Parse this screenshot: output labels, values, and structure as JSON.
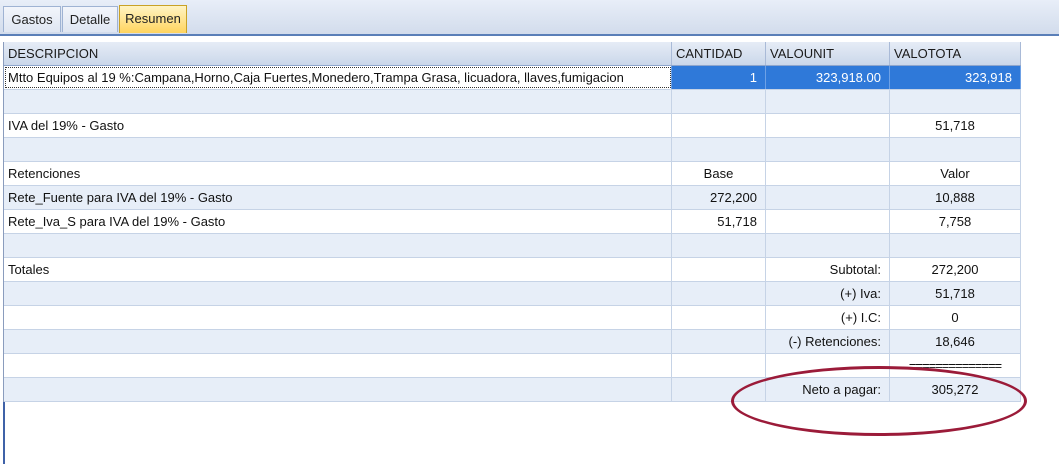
{
  "tabs": [
    {
      "label": "Gastos"
    },
    {
      "label": "Detalle"
    },
    {
      "label": "Resumen"
    }
  ],
  "grid": {
    "headers": [
      "DESCRIPCION",
      "CANTIDAD",
      "VALOUNIT",
      "VALOTOTA"
    ],
    "rows": [
      {
        "desc": "Mtto Equipos al 19 %:Campana,Horno,Caja Fuertes,Monedero,Trampa Grasa, licuadora, llaves,fumigacion",
        "qty": "1",
        "unit": "323,918.00",
        "total": "323,918"
      },
      {
        "desc": "",
        "qty": "",
        "unit": "",
        "total": ""
      },
      {
        "desc": "IVA del 19% - Gasto",
        "qty": "",
        "unit": "",
        "total": "51,718"
      },
      {
        "desc": "",
        "qty": "",
        "unit": "",
        "total": ""
      },
      {
        "desc": "Retenciones",
        "qty": "Base",
        "unit": "",
        "total": "Valor"
      },
      {
        "desc": "Rete_Fuente para IVA del 19% - Gasto",
        "qty": "272,200",
        "unit": "",
        "total": "10,888"
      },
      {
        "desc": "Rete_Iva_S para IVA del 19% - Gasto",
        "qty": "51,718",
        "unit": "",
        "total": "7,758"
      },
      {
        "desc": "",
        "qty": "",
        "unit": "",
        "total": ""
      },
      {
        "desc": "Totales",
        "qty": "",
        "unit": "Subtotal:",
        "total": "272,200"
      },
      {
        "desc": "",
        "qty": "",
        "unit": "(+) Iva:",
        "total": "51,718"
      },
      {
        "desc": "",
        "qty": "",
        "unit": "(+) I.C:",
        "total": "0"
      },
      {
        "desc": "",
        "qty": "",
        "unit": "(-) Retenciones:",
        "total": "18,646"
      },
      {
        "desc": "",
        "qty": "",
        "unit": "",
        "total": "=============="
      },
      {
        "desc": "",
        "qty": "",
        "unit": "Neto a pagar:",
        "total": "305,272"
      }
    ]
  },
  "colors": {
    "selected_row": "#2f79d9",
    "active_tab": "#ffd45e",
    "annotation": "#9b1b39"
  }
}
